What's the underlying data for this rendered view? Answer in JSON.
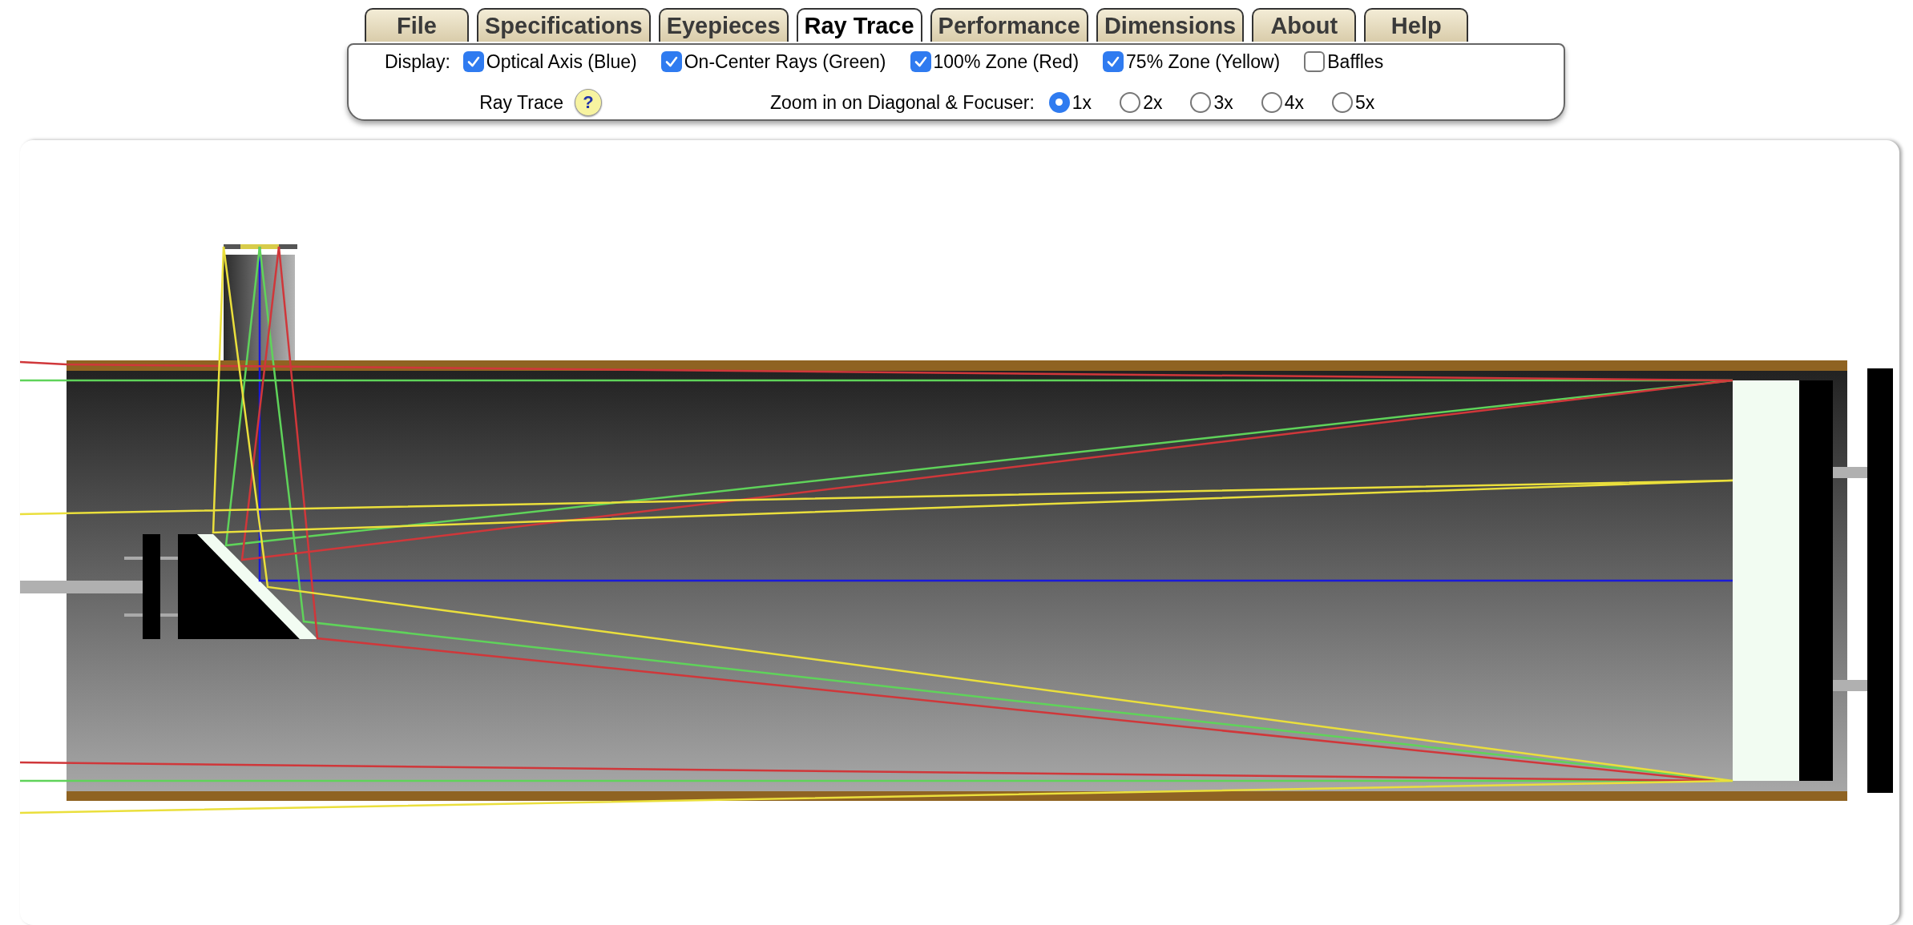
{
  "tabs": [
    {
      "label": "File",
      "selected": false
    },
    {
      "label": "Specifications",
      "selected": false
    },
    {
      "label": "Eyepieces",
      "selected": false
    },
    {
      "label": "Ray Trace",
      "selected": true
    },
    {
      "label": "Performance",
      "selected": false
    },
    {
      "label": "Dimensions",
      "selected": false
    },
    {
      "label": "About",
      "selected": false
    },
    {
      "label": "Help",
      "selected": false
    }
  ],
  "display": {
    "label": "Display:",
    "options": [
      {
        "label": "Optical Axis (Blue)",
        "checked": true,
        "kind": "axis"
      },
      {
        "label": "On-Center Rays (Green)",
        "checked": true,
        "kind": "center"
      },
      {
        "label": "100% Zone (Red)",
        "checked": true,
        "kind": "full"
      },
      {
        "label": "75% Zone (Yellow)",
        "checked": true,
        "kind": "partial"
      },
      {
        "label": "Baffles",
        "checked": false,
        "kind": "baffles"
      }
    ]
  },
  "ray_trace": {
    "label": "Ray Trace",
    "help": "?"
  },
  "zoom": {
    "label": "Zoom in on Diagonal & Focuser:",
    "options": [
      {
        "label": "1x",
        "selected": true
      },
      {
        "label": "2x",
        "selected": false
      },
      {
        "label": "3x",
        "selected": false
      },
      {
        "label": "4x",
        "selected": false
      },
      {
        "label": "5x",
        "selected": false
      }
    ]
  }
}
